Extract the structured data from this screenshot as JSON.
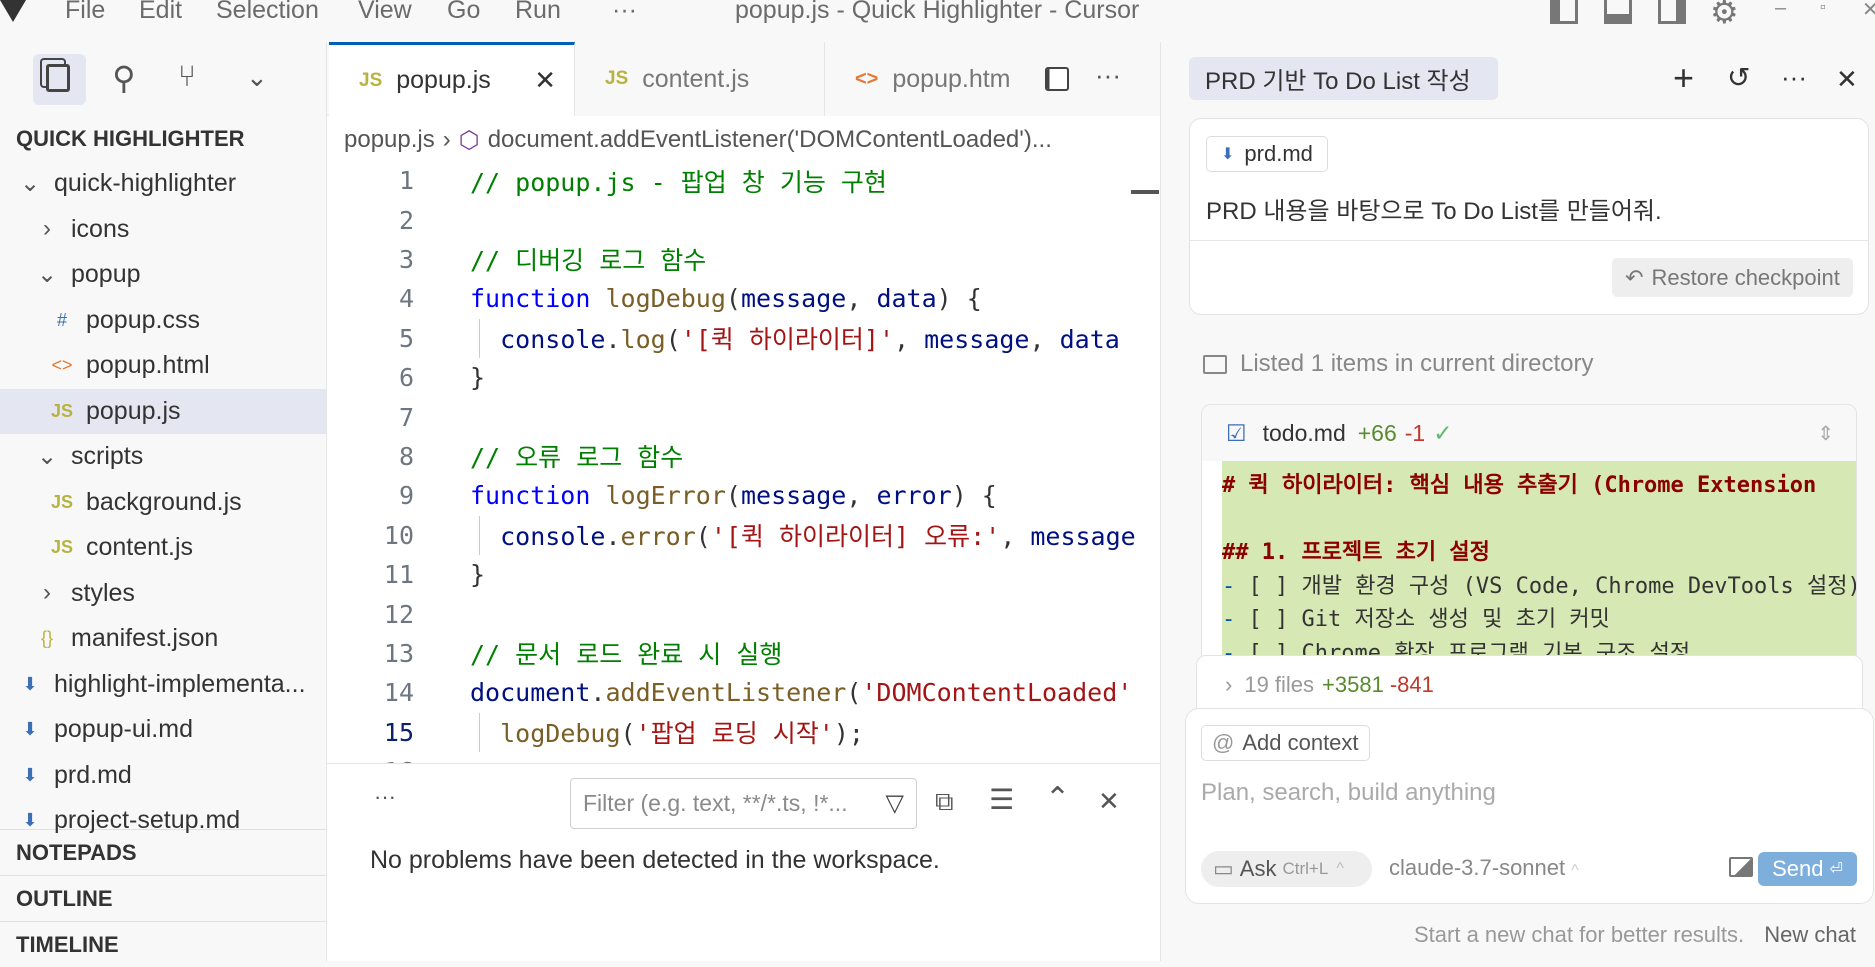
{
  "titlebar": {
    "menu": [
      "File",
      "Edit",
      "Selection",
      "View",
      "Go",
      "Run",
      "···"
    ],
    "title": "popup.js - Quick Highlighter - Cursor"
  },
  "sidebar": {
    "title": "QUICK HIGHLIGHTER",
    "tree": [
      {
        "label": "quick-highlighter",
        "icon": "chevron-down",
        "level": 0,
        "glyph": "⌄"
      },
      {
        "label": "icons",
        "icon": "chevron-right",
        "level": 1,
        "glyph": "›"
      },
      {
        "label": "popup",
        "icon": "chevron-down",
        "level": 1,
        "glyph": "⌄"
      },
      {
        "label": "popup.css",
        "icon": "css-file",
        "level": 2,
        "glyph": "#"
      },
      {
        "label": "popup.html",
        "icon": "html-file",
        "level": 2,
        "glyph": "<>"
      },
      {
        "label": "popup.js",
        "icon": "js-file",
        "level": 2,
        "glyph": "JS",
        "selected": true
      },
      {
        "label": "scripts",
        "icon": "chevron-down",
        "level": 1,
        "glyph": "⌄"
      },
      {
        "label": "background.js",
        "icon": "js-file",
        "level": 2,
        "glyph": "JS"
      },
      {
        "label": "content.js",
        "icon": "js-file",
        "level": 2,
        "glyph": "JS"
      },
      {
        "label": "styles",
        "icon": "chevron-right",
        "level": 1,
        "glyph": "›"
      },
      {
        "label": "manifest.json",
        "icon": "json-file",
        "level": 1,
        "glyph": "{}"
      },
      {
        "label": "highlight-implementa...",
        "icon": "markdown-file",
        "level": 0,
        "glyph": "⬇"
      },
      {
        "label": "popup-ui.md",
        "icon": "markdown-file",
        "level": 0,
        "glyph": "⬇"
      },
      {
        "label": "prd.md",
        "icon": "markdown-file",
        "level": 0,
        "glyph": "⬇"
      },
      {
        "label": "project-setup.md",
        "icon": "markdown-file",
        "level": 0,
        "glyph": "⬇"
      }
    ],
    "sections": [
      "NOTEPADS",
      "OUTLINE",
      "TIMELINE"
    ]
  },
  "editor": {
    "tabs": [
      {
        "label": "popup.js",
        "icon": "JS",
        "active": true
      },
      {
        "label": "content.js",
        "icon": "JS"
      },
      {
        "label": "popup.htm",
        "icon": "<>"
      }
    ],
    "breadcrumb": {
      "file": "popup.js",
      "symbol": "document.addEventListener('DOMContentLoaded')..."
    },
    "current_line": 15,
    "lines": [
      [
        [
          "// popup.js - 팝업 창 기능 구현",
          "com"
        ]
      ],
      [],
      [
        [
          "// 디버깅 로그 함수",
          "com"
        ]
      ],
      [
        [
          "function",
          "kw"
        ],
        [
          " ",
          "p"
        ],
        [
          "logDebug",
          "fn"
        ],
        [
          "(",
          "p"
        ],
        [
          "message",
          "var"
        ],
        [
          ", ",
          "p"
        ],
        [
          "data",
          "var"
        ],
        [
          ") {",
          "p"
        ]
      ],
      [
        [
          "  ",
          "p"
        ],
        [
          "console",
          "var"
        ],
        [
          ".",
          "p"
        ],
        [
          "log",
          "fn"
        ],
        [
          "(",
          "p"
        ],
        [
          "'[퀵 하이라이터]'",
          "str"
        ],
        [
          ", ",
          "p"
        ],
        [
          "message",
          "var"
        ],
        [
          ", ",
          "p"
        ],
        [
          "data",
          "var"
        ]
      ],
      [
        [
          "}",
          "p"
        ]
      ],
      [],
      [
        [
          "// 오류 로그 함수",
          "com"
        ]
      ],
      [
        [
          "function",
          "kw"
        ],
        [
          " ",
          "p"
        ],
        [
          "logError",
          "fn"
        ],
        [
          "(",
          "p"
        ],
        [
          "message",
          "var"
        ],
        [
          ", ",
          "p"
        ],
        [
          "error",
          "var"
        ],
        [
          ") {",
          "p"
        ]
      ],
      [
        [
          "  ",
          "p"
        ],
        [
          "console",
          "var"
        ],
        [
          ".",
          "p"
        ],
        [
          "error",
          "fn"
        ],
        [
          "(",
          "p"
        ],
        [
          "'[퀵 하이라이터] 오류:'",
          "str"
        ],
        [
          ", ",
          "p"
        ],
        [
          "message",
          "var"
        ]
      ],
      [
        [
          "}",
          "p"
        ]
      ],
      [],
      [
        [
          "// 문서 로드 완료 시 실행",
          "com"
        ]
      ],
      [
        [
          "document",
          "var"
        ],
        [
          ".",
          "p"
        ],
        [
          "addEventListener",
          "fn"
        ],
        [
          "(",
          "p"
        ],
        [
          "'DOMContentLoaded'",
          "str"
        ]
      ],
      [
        [
          "  ",
          "p"
        ],
        [
          "logDebug",
          "fn"
        ],
        [
          "(",
          "p"
        ],
        [
          "'팝업 로딩 시작'",
          "str"
        ],
        [
          ");",
          "p"
        ]
      ],
      []
    ]
  },
  "panel": {
    "more": "···",
    "filter_placeholder": "Filter (e.g. text, **/*.ts, !*...",
    "message": "No problems have been detected in the workspace."
  },
  "chat": {
    "title": "PRD 기반 To Do List 작성",
    "attachment": "prd.md",
    "user_message": "PRD 내용을 바탕으로 To Do List를 만들어줘.",
    "restore_label": "Restore checkpoint",
    "listed": "Listed 1 items in current directory",
    "diff": {
      "file": "todo.md",
      "added": "+66",
      "removed": "-1",
      "lines": [
        [
          "# 퀵 하이라이터: 핵심 내용 추출기 (Chrome Extension",
          "h"
        ],
        [
          "",
          ""
        ],
        [
          "## 1. 프로젝트 초기 설정",
          "h"
        ],
        [
          "- [ ] 개발 환경 구성 (VS Code, Chrome DevTools 설정)",
          "l"
        ],
        [
          "- [ ] Git 저장소 생성 및 초기 커밋",
          "l"
        ],
        [
          "- [ ] Chrome 확장 프로그램 기본 구조 설정",
          "l"
        ]
      ]
    },
    "files_summary": {
      "count": "19 files",
      "added": "+3581",
      "removed": "-841"
    },
    "add_context": "Add context",
    "input_placeholder": "Plan, search, build anything",
    "mode": "Ask",
    "mode_shortcut": "Ctrl+L",
    "model": "claude-3.7-sonnet",
    "send": "Send",
    "footer_hint": "Start a new chat for better results.",
    "new_chat": "New chat"
  },
  "colors": {
    "accent": "#005fb8",
    "send": "#7eaedc",
    "diff_bg": "#d6e8b3",
    "added": "#5a8a2f",
    "removed": "#c0392b"
  }
}
